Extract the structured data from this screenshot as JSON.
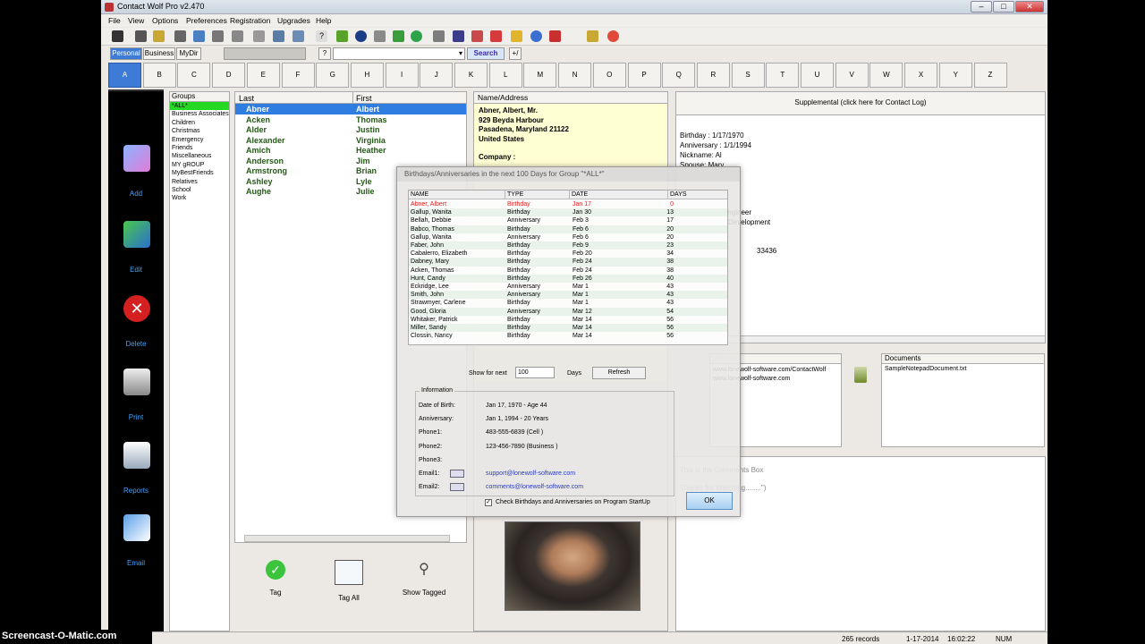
{
  "window": {
    "title": "Contact Wolf Pro v2.470"
  },
  "menu": [
    "File",
    "View",
    "Options",
    "Preferences",
    "Registration",
    "Upgrades",
    "Help"
  ],
  "views": {
    "personal": "Personal",
    "business": "Business",
    "mydir": "MyDir",
    "search": "Search"
  },
  "letters": [
    "A",
    "B",
    "C",
    "D",
    "E",
    "F",
    "G",
    "H",
    "I",
    "J",
    "K",
    "L",
    "M",
    "N",
    "O",
    "P",
    "Q",
    "R",
    "S",
    "T",
    "U",
    "V",
    "W",
    "X",
    "Y",
    "Z"
  ],
  "nav": {
    "add": "Add",
    "edit": "Edit",
    "delete": "Delete",
    "print": "Print",
    "reports": "Reports",
    "email": "Email"
  },
  "groups": {
    "header": "Groups",
    "items": [
      "*ALL*",
      "Business Associates",
      "Children",
      "Christmas",
      "Emergency",
      "Friends",
      "Miscellaneous",
      "MY gROUP",
      "MyBestFriends",
      "Relatives",
      "School",
      "Work"
    ]
  },
  "contacts": {
    "headers": {
      "last": "Last",
      "first": "First"
    },
    "rows": [
      {
        "last": "Abner",
        "first": "Albert"
      },
      {
        "last": "Acken",
        "first": "Thomas"
      },
      {
        "last": "Alder",
        "first": "Justin"
      },
      {
        "last": "Alexander",
        "first": "Virginia"
      },
      {
        "last": "Amich",
        "first": "Heather"
      },
      {
        "last": "Anderson",
        "first": "Jim"
      },
      {
        "last": "Armstrong",
        "first": "Brian"
      },
      {
        "last": "Ashley",
        "first": "Lyle"
      },
      {
        "last": "Aughe",
        "first": "Julie"
      }
    ]
  },
  "tags": {
    "tag": "Tag",
    "tag_all": "Tag All",
    "show_tagged": "Show Tagged"
  },
  "name_address": {
    "header": "Name/Address",
    "line1": "Abner, Albert, Mr.",
    "line2": "929 Beyda Harbour",
    "line3": "Pasadena, Maryland  21122",
    "line4": "United States",
    "company_label": "Company :"
  },
  "supplemental": {
    "header": "Supplemental (click here for Contact Log)",
    "birthday": "Birthday :  1/17/1970",
    "anniversary": "Anniversary :  1/1/1994",
    "nickname": "Nickname:  Al",
    "spouse": "Spouse:  Mary",
    "profession": "Engineer",
    "department": "Development",
    "zip": "33436"
  },
  "urls": {
    "header": "Website",
    "items": [
      "www.lonewolf-software.com/ContactWolf",
      "www.lonewolf-software.com"
    ]
  },
  "documents": {
    "header": "Documents",
    "items": [
      "SampleNotepadDocument.txt"
    ]
  },
  "comments": {
    "line1": "This is the Comments Box",
    "line2": "Thanks for Watching........\")"
  },
  "status": {
    "records": "265 records",
    "date": "1-17-2014",
    "time": "16:02:22",
    "num": "NUM"
  },
  "dialog": {
    "title": "Birthdays/Anniversaries in the next 100 Days for Group \"*ALL*\"",
    "columns": {
      "name": "NAME",
      "type": "TYPE",
      "date": "DATE",
      "days": "DAYS"
    },
    "rows": [
      {
        "name": "Abner, Albert",
        "type": "Birthday",
        "date": "Jan 17",
        "days": "0"
      },
      {
        "name": "Gallup, Wanita",
        "type": "Birthday",
        "date": "Jan 30",
        "days": "13"
      },
      {
        "name": "Bellah, Debbie",
        "type": "Anniversary",
        "date": "Feb 3",
        "days": "17"
      },
      {
        "name": "Babco, Thomas",
        "type": "Birthday",
        "date": "Feb 6",
        "days": "20"
      },
      {
        "name": "Gallup, Wanita",
        "type": "Anniversary",
        "date": "Feb 6",
        "days": "20"
      },
      {
        "name": "Faber, John",
        "type": "Birthday",
        "date": "Feb 9",
        "days": "23"
      },
      {
        "name": "Cabalerro, Elizabeth",
        "type": "Birthday",
        "date": "Feb 20",
        "days": "34"
      },
      {
        "name": "Dabney, Mary",
        "type": "Birthday",
        "date": "Feb 24",
        "days": "38"
      },
      {
        "name": "Acken, Thomas",
        "type": "Birthday",
        "date": "Feb 24",
        "days": "38"
      },
      {
        "name": "Hunt, Candy",
        "type": "Birthday",
        "date": "Feb 26",
        "days": "40"
      },
      {
        "name": "Eckridge, Lee",
        "type": "Anniversary",
        "date": "Mar 1",
        "days": "43"
      },
      {
        "name": "Smith, John",
        "type": "Anniversary",
        "date": "Mar 1",
        "days": "43"
      },
      {
        "name": "Strawmyer, Carlene",
        "type": "Birthday",
        "date": "Mar 1",
        "days": "43"
      },
      {
        "name": "Good, Gloria",
        "type": "Anniversary",
        "date": "Mar 12",
        "days": "54"
      },
      {
        "name": "Whitaker, Patrick",
        "type": "Birthday",
        "date": "Mar 14",
        "days": "56"
      },
      {
        "name": "Miller, Sandy",
        "type": "Birthday",
        "date": "Mar 14",
        "days": "56"
      },
      {
        "name": "Clossin, Nancy",
        "type": "Birthday",
        "date": "Mar 14",
        "days": "56"
      }
    ],
    "show_for_next_label": "Show for next",
    "show_for_next_value": "100",
    "days_label": "Days",
    "refresh_label": "Refresh",
    "info_label": "Information",
    "dob_label": "Date of Birth:",
    "dob_value": "Jan 17, 1970 - Age 44",
    "anniv_label": "Anniversary:",
    "anniv_value": "Jan 1, 1994 - 20 Years",
    "phone1_label": "Phone1:",
    "phone1_value": "483-555-6839  (Cell )",
    "phone2_label": "Phone2:",
    "phone2_value": "123-456-7890  (Business )",
    "phone3_label": "Phone3:",
    "email1_label": "Email1:",
    "email1_value": "support@lonewolf-software.com",
    "email2_label": "Email2:",
    "email2_value": "comments@lonewolf-software.com",
    "check_label": "Check Birthdays and Anniversaries on Program StartUp",
    "ok_label": "OK"
  },
  "watermark": "Screencast-O-Matic.com",
  "colors": {
    "accent": "#3d7bd6",
    "selected_group": "#24d824",
    "contact_text": "#245a16",
    "nav_text": "#3ea3ff"
  }
}
